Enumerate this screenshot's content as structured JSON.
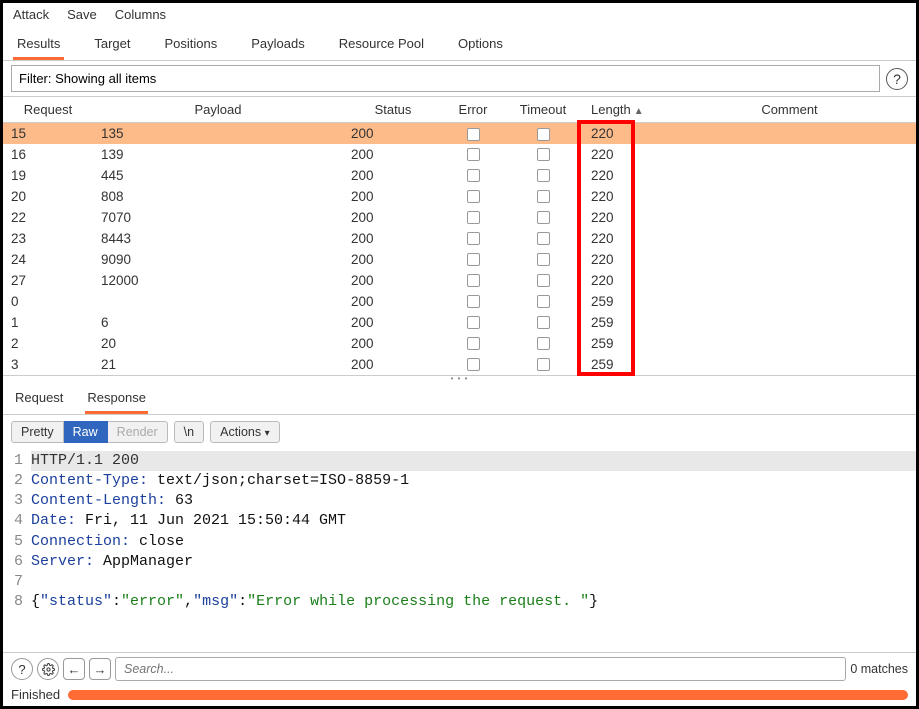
{
  "menu": {
    "attack": "Attack",
    "save": "Save",
    "columns": "Columns"
  },
  "tabs": {
    "results": "Results",
    "target": "Target",
    "positions": "Positions",
    "payloads": "Payloads",
    "resource_pool": "Resource Pool",
    "options": "Options"
  },
  "filter": {
    "value": "Filter: Showing all items"
  },
  "columns": {
    "request": "Request",
    "payload": "Payload",
    "status": "Status",
    "error": "Error",
    "timeout": "Timeout",
    "length": "Length",
    "comment": "Comment"
  },
  "rows": [
    {
      "request": "15",
      "payload": "135",
      "status": "200",
      "length": "220",
      "selected": true
    },
    {
      "request": "16",
      "payload": "139",
      "status": "200",
      "length": "220"
    },
    {
      "request": "19",
      "payload": "445",
      "status": "200",
      "length": "220"
    },
    {
      "request": "20",
      "payload": "808",
      "status": "200",
      "length": "220"
    },
    {
      "request": "22",
      "payload": "7070",
      "status": "200",
      "length": "220"
    },
    {
      "request": "23",
      "payload": "8443",
      "status": "200",
      "length": "220"
    },
    {
      "request": "24",
      "payload": "9090",
      "status": "200",
      "length": "220"
    },
    {
      "request": "27",
      "payload": "12000",
      "status": "200",
      "length": "220"
    },
    {
      "request": "0",
      "payload": "",
      "status": "200",
      "length": "259"
    },
    {
      "request": "1",
      "payload": "6",
      "status": "200",
      "length": "259"
    },
    {
      "request": "2",
      "payload": "20",
      "status": "200",
      "length": "259"
    },
    {
      "request": "3",
      "payload": "21",
      "status": "200",
      "length": "259"
    }
  ],
  "subtabs": {
    "request": "Request",
    "response": "Response"
  },
  "view": {
    "pretty": "Pretty",
    "raw": "Raw",
    "render": "Render",
    "newline": "\\n",
    "actions": "Actions"
  },
  "raw_lines": [
    {
      "n": "1",
      "plain": "HTTP/1.1 200",
      "first": true
    },
    {
      "n": "2",
      "k": "Content-Type:",
      "v": " text/json;charset=ISO-8859-1"
    },
    {
      "n": "3",
      "k": "Content-Length:",
      "v": " 63"
    },
    {
      "n": "4",
      "k": "Date:",
      "v": " Fri, 11 Jun 2021 15:50:44 GMT"
    },
    {
      "n": "5",
      "k": "Connection:",
      "v": " close"
    },
    {
      "n": "6",
      "k": "Server:",
      "v": " AppManager"
    },
    {
      "n": "7",
      "plain": ""
    },
    {
      "n": "8",
      "json": [
        {
          "t": "{",
          "c": "hv"
        },
        {
          "t": "\"status\"",
          "c": "hk"
        },
        {
          "t": ":",
          "c": "hv"
        },
        {
          "t": "\"error\"",
          "c": "jg"
        },
        {
          "t": ",",
          "c": "hv"
        },
        {
          "t": "\"msg\"",
          "c": "hk"
        },
        {
          "t": ":",
          "c": "hv"
        },
        {
          "t": "\"Error while processing the request. \"",
          "c": "jg"
        },
        {
          "t": "}",
          "c": "hv"
        }
      ]
    }
  ],
  "search": {
    "placeholder": "Search...",
    "matches": "0 matches"
  },
  "status": {
    "label": "Finished"
  }
}
